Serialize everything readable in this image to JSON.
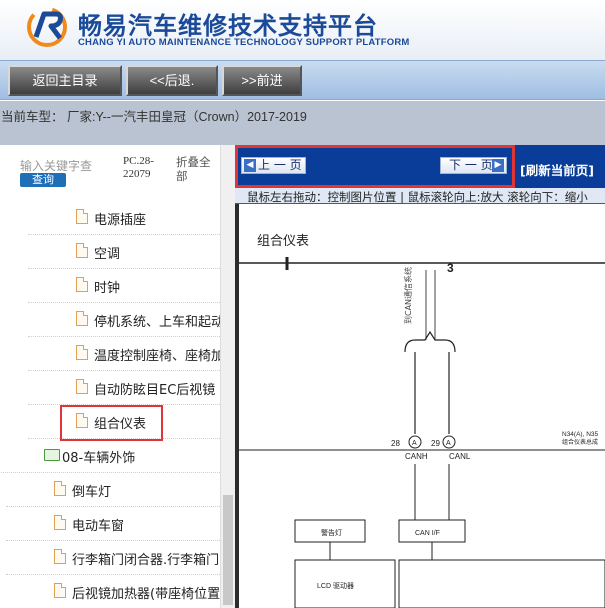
{
  "app": {
    "title_cn": "畅易汽车维修技术支持平台",
    "title_en": "CHANG YI AUTO MAINTENANCE TECHNOLOGY SUPPORT PLATFORM"
  },
  "toolbar": {
    "home_label": "返回主目录",
    "back_label": "<<后退.",
    "forward_label": ">>前进"
  },
  "vehicle": {
    "current_label": "当前车型：  厂家:Y--一汽丰田皇冠（Crown）2017-2019"
  },
  "sidebar": {
    "search_placeholder": "输入关键字查",
    "search_button": "查询",
    "version": "PC.28-22079",
    "collapse_label": "折叠全部",
    "items": [
      {
        "label": "电源插座",
        "type": "file"
      },
      {
        "label": "空调",
        "type": "file"
      },
      {
        "label": "时钟",
        "type": "file"
      },
      {
        "label": "停机系统、上车和起动",
        "type": "file"
      },
      {
        "label": "温度控制座椅、座椅加",
        "type": "file"
      },
      {
        "label": "自动防眩目EC后视镜",
        "type": "file"
      },
      {
        "label": "组合仪表",
        "type": "file",
        "selected": true
      },
      {
        "label": "08-车辆外饰",
        "type": "folder"
      },
      {
        "label": "倒车灯",
        "type": "file"
      },
      {
        "label": "电动车窗",
        "type": "file"
      },
      {
        "label": "行李箱门闭合器.行李箱门",
        "type": "file"
      },
      {
        "label": "后视镜加热器(带座椅位置",
        "type": "file"
      }
    ]
  },
  "viewer": {
    "prev_label": "上 一 页",
    "next_label": "下 一 页",
    "refresh_label": "[刷新当前页]",
    "hint": "鼠标左右拖动：控制图片位置 | 鼠标滚轮向上:放大   滚轮向下：缩小",
    "diagram": {
      "title": "组合仪表",
      "pin_3": "3",
      "pin_28": "28",
      "pin_29": "29",
      "canh": "CANH",
      "canl": "CANL",
      "box_1": "警告灯",
      "box_2": "CAN I/F",
      "box_3": "LCD 驱动器",
      "connector": "N34(A), N35",
      "connector_sub": "组合仪表总成",
      "wire_label": "到CAN通信系统"
    }
  }
}
